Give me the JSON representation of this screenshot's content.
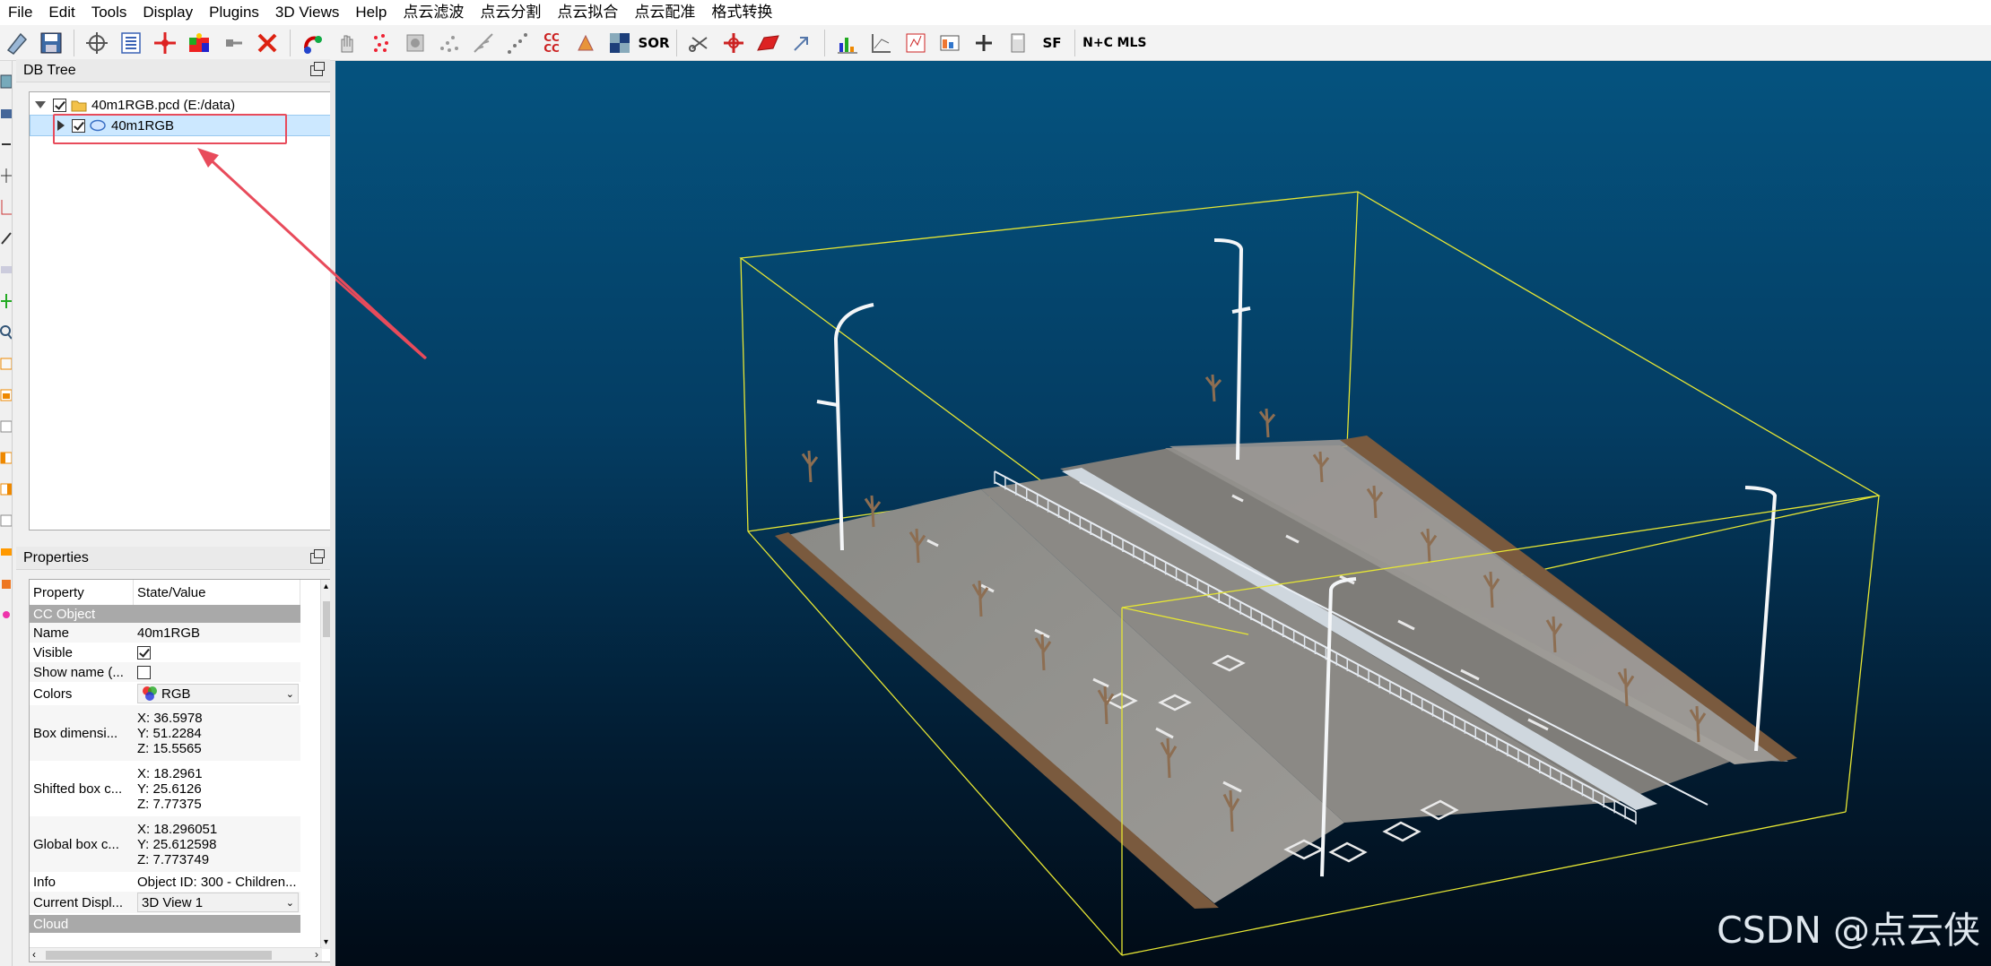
{
  "menu": [
    "File",
    "Edit",
    "Tools",
    "Display",
    "Plugins",
    "3D Views",
    "Help",
    "点云滤波",
    "点云分割",
    "点云拟合",
    "点云配准",
    "格式转换"
  ],
  "toolbar": {
    "text_icons": {
      "cc": "CC\nCC",
      "sor": "SOR",
      "sf": "SF",
      "nc": "N+C",
      "mls": "MLS"
    }
  },
  "db_tree": {
    "title": "DB Tree",
    "root_label": "40m1RGB.pcd (E:/data)",
    "child_label": "40m1RGB",
    "root_checked": true,
    "child_checked": true
  },
  "properties": {
    "title": "Properties",
    "columns": [
      "Property",
      "State/Value"
    ],
    "section_object": "CC Object",
    "name_key": "Name",
    "name_value": "40m1RGB",
    "visible_key": "Visible",
    "visible_checked": true,
    "showname_key": "Show name (...",
    "showname_checked": false,
    "colors_key": "Colors",
    "colors_value": "RGB",
    "boxdim_key": "Box dimensi...",
    "boxdim": [
      "X: 36.5978",
      "Y: 51.2284",
      "Z: 15.5565"
    ],
    "shifted_key": "Shifted box c...",
    "shifted": [
      "X: 18.2961",
      "Y: 25.6126",
      "Z: 7.77375"
    ],
    "global_key": "Global box c...",
    "global": [
      "X: 18.296051",
      "Y: 25.612598",
      "Z: 7.773749"
    ],
    "info_key": "Info",
    "info_value": "Object ID: 300 - Children...",
    "display_key": "Current Displ...",
    "display_value": "3D View 1",
    "section_cloud": "Cloud"
  },
  "watermark": "CSDN @点云侠",
  "colors": {
    "annotation": "#e84b5b",
    "bbox": "#e6e634",
    "selection": "#cce8ff",
    "section": "#a9a9a9"
  },
  "icons": [
    "new-icon",
    "save-icon",
    "pick-center-icon",
    "list-icon",
    "translate-icon",
    "rgb-cloud-icon",
    "segment-icon",
    "delete-icon",
    "sample-icon",
    "hand-icon",
    "points-icon",
    "normals-icon",
    "cloud-compare-icon",
    "sor-icon",
    "scissors-icon",
    "transform-icon",
    "plane-icon",
    "histogram-icon",
    "statistics-icon",
    "calculator-icon",
    "sf-icon",
    "nc-icon",
    "mls-icon"
  ]
}
